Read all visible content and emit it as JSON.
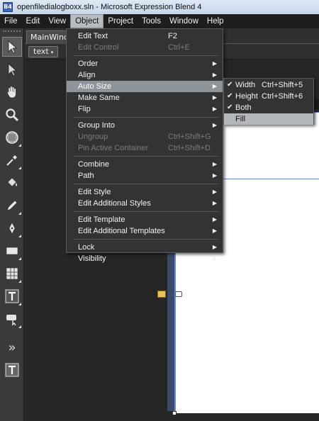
{
  "window": {
    "title": "openfiledialogboxx.sln - Microsoft Expression Blend 4",
    "app_icon_text": "B4"
  },
  "menubar": [
    "File",
    "Edit",
    "View",
    "Object",
    "Project",
    "Tools",
    "Window",
    "Help"
  ],
  "document": {
    "tab_label": "MainWindow",
    "breadcrumb": "text",
    "breadcrumb_arrow": "▾"
  },
  "object_menu": {
    "items": [
      {
        "label": "Edit Text",
        "shortcut": "F2",
        "enabled": true
      },
      {
        "label": "Edit Control",
        "shortcut": "Ctrl+E",
        "enabled": false
      },
      {
        "label": "Order",
        "submenu": true,
        "enabled": true
      },
      {
        "label": "Align",
        "submenu": true,
        "enabled": true
      },
      {
        "label": "Auto Size",
        "submenu": true,
        "enabled": true,
        "highlighted": true
      },
      {
        "label": "Make Same",
        "submenu": true,
        "enabled": true
      },
      {
        "label": "Flip",
        "submenu": true,
        "enabled": true
      },
      {
        "label": "Group Into",
        "submenu": true,
        "enabled": true
      },
      {
        "label": "Ungroup",
        "shortcut": "Ctrl+Shift+G",
        "enabled": false
      },
      {
        "label": "Pin Active Container",
        "shortcut": "Ctrl+Shift+D",
        "enabled": false
      },
      {
        "label": "Combine",
        "submenu": true,
        "enabled": true
      },
      {
        "label": "Path",
        "submenu": true,
        "enabled": true
      },
      {
        "label": "Edit Style",
        "submenu": true,
        "enabled": true
      },
      {
        "label": "Edit Additional Styles",
        "submenu": true,
        "enabled": true
      },
      {
        "label": "Edit Template",
        "submenu": true,
        "enabled": true
      },
      {
        "label": "Edit Additional Templates",
        "submenu": true,
        "enabled": true
      },
      {
        "label": "Lock",
        "submenu": true,
        "enabled": true
      },
      {
        "label": "Visibility",
        "submenu": true,
        "enabled": true
      }
    ],
    "submenu_glyph": "▶"
  },
  "autosize_submenu": {
    "items": [
      {
        "label": "Width",
        "shortcut": "Ctrl+Shift+5",
        "checked": true
      },
      {
        "label": "Height",
        "shortcut": "Ctrl+Shift+6",
        "checked": true
      },
      {
        "label": "Both",
        "shortcut": "",
        "checked": true
      },
      {
        "label": "Fill",
        "shortcut": "",
        "checked": false,
        "highlighted": true
      }
    ],
    "check_glyph": "✔"
  },
  "toolbar": {
    "tools": [
      "selection-tool",
      "direct-selection-tool",
      "pan-tool",
      "zoom-tool",
      "camera-orbit-tool",
      "eyedropper-tool",
      "paint-bucket-tool",
      "pencil-tool",
      "pen-tool",
      "rectangle-tool",
      "grid-tool",
      "textblock-tool",
      "assets-tool",
      "more-tools",
      "active-text-tool"
    ],
    "more_glyph": "»"
  }
}
